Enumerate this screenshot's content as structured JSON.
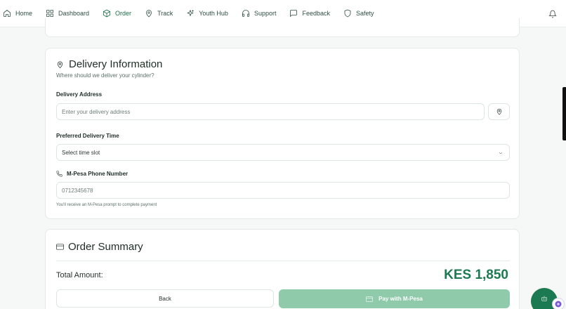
{
  "nav": {
    "items": [
      {
        "label": "Home",
        "icon": "home-icon",
        "active": false
      },
      {
        "label": "Dashboard",
        "icon": "dashboard-icon",
        "active": false
      },
      {
        "label": "Order",
        "icon": "box-icon",
        "active": true
      },
      {
        "label": "Track",
        "icon": "map-pin-icon",
        "active": false
      },
      {
        "label": "Youth Hub",
        "icon": "sparkles-icon",
        "active": false
      },
      {
        "label": "Support",
        "icon": "headphones-icon",
        "active": false
      },
      {
        "label": "Feedback",
        "icon": "message-icon",
        "active": false
      },
      {
        "label": "Safety",
        "icon": "shield-icon",
        "active": false
      }
    ],
    "notifications_icon": "bell-icon"
  },
  "delivery": {
    "title": "Delivery Information",
    "subtitle": "Where should we deliver your cylinder?",
    "address": {
      "label": "Delivery Address",
      "placeholder": "Enter your delivery address",
      "value": ""
    },
    "time": {
      "label": "Preferred Delivery Time",
      "selected": "Select time slot"
    },
    "phone": {
      "label": "M-Pesa Phone Number",
      "placeholder": "0712345678",
      "value": "",
      "hint": "You'll receive an M-Pesa prompt to complete payment"
    }
  },
  "summary": {
    "title": "Order Summary",
    "total_label": "Total Amount:",
    "total_amount": "KES 1,850",
    "back_label": "Back",
    "pay_label": "Pay with M-Pesa"
  },
  "colors": {
    "accent": "#1c7a52",
    "pay_button_disabled": "#8fcaab",
    "background": "#f6f8f7"
  }
}
